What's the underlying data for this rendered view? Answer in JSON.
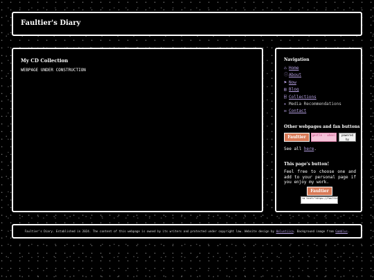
{
  "header": {
    "site_title": "Faultier's Diary"
  },
  "main": {
    "title": "My CD Collection",
    "body": "WEBPAGE UNDER CONSTRUCTION"
  },
  "sidebar": {
    "nav_heading": "Navigation",
    "nav_items": [
      {
        "icon": "⌂",
        "label": "Home"
      },
      {
        "icon": "ⓘ",
        "label": "About"
      },
      {
        "icon": "⚑",
        "label": "Now"
      },
      {
        "icon": "▤",
        "label": "Blog"
      },
      {
        "icon": "⌸",
        "label": "Collections"
      },
      {
        "icon": "▸",
        "label": "Media Recommendations"
      },
      {
        "icon": "✉",
        "label": "Contact"
      }
    ],
    "other_heading": "Other webpages and fan buttons",
    "buttons": [
      {
        "text": "Faultier"
      },
      {
        "text": "gentle ♡ wheel"
      },
      {
        "text": "powered by Prologue"
      }
    ],
    "see_all_prefix": "See all ",
    "see_all_link": "here",
    "see_all_suffix": ".",
    "page_button_heading": "This page's button!",
    "page_button_text": "Feel free to choose one and add to your personal page if you enjoy my work.",
    "page_button_label": "Faultier",
    "code_snippet": "<a href=\"https://faultier..."
  },
  "footer": {
    "text_before": "Faultier's Diary. Established in 2024. The content of this webpage is owned by its writers and protected under copyright law. Website design by ",
    "design_link": "Helvetiica",
    "text_middle": ". Background image from ",
    "bg_link": "Gamblus",
    "text_after": "."
  }
}
